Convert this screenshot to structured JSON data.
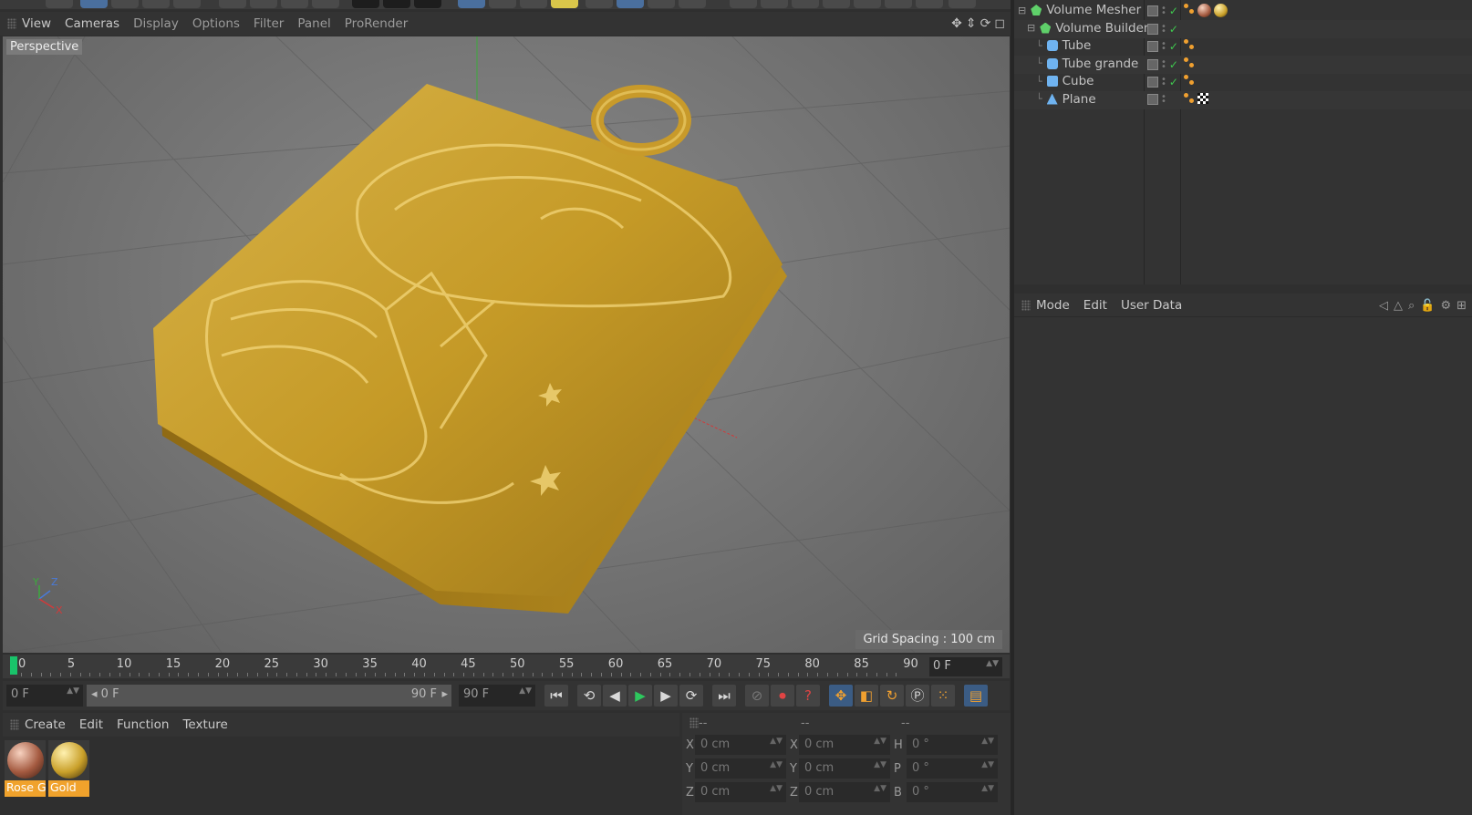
{
  "viewport": {
    "menu": [
      "View",
      "Cameras",
      "Display",
      "Options",
      "Filter",
      "Panel",
      "ProRender"
    ],
    "label": "Perspective",
    "grid_spacing": "Grid Spacing : 100 cm",
    "axis_labels": {
      "y": "Y",
      "z": "Z",
      "x": "X"
    }
  },
  "timeline": {
    "ticks": [
      "0",
      "5",
      "10",
      "15",
      "20",
      "25",
      "30",
      "35",
      "40",
      "45",
      "50",
      "55",
      "60",
      "65",
      "70",
      "75",
      "80",
      "85",
      "90"
    ],
    "current_frame": "0 F"
  },
  "transport": {
    "start_field": "0 F",
    "range_start": "0 F",
    "range_end": "90 F",
    "end_field": "90 F"
  },
  "materials": {
    "menu": [
      "Create",
      "Edit",
      "Function",
      "Texture"
    ],
    "items": [
      {
        "label": "Rose G",
        "color": "#b06a50"
      },
      {
        "label": "Gold",
        "color": "#d9a620"
      }
    ]
  },
  "coordinates": {
    "headers": [
      "--",
      "--",
      "--"
    ],
    "rows": [
      {
        "a": "X",
        "a_val": "0 cm",
        "b": "X",
        "b_val": "0 cm",
        "c": "H",
        "c_val": "0 °"
      },
      {
        "a": "Y",
        "a_val": "0 cm",
        "b": "Y",
        "b_val": "0 cm",
        "c": "P",
        "c_val": "0 °"
      },
      {
        "a": "Z",
        "a_val": "0 cm",
        "b": "Z",
        "b_val": "0 cm",
        "c": "B",
        "c_val": "0 °"
      }
    ]
  },
  "objects": [
    {
      "name": "Volume Mesher",
      "icon": "volume-mesher-icon",
      "indent": 0,
      "tags": [
        "phong",
        "rose-gold-material",
        "gold-material"
      ]
    },
    {
      "name": "Volume Builder",
      "icon": "volume-builder-icon",
      "indent": 1,
      "tags": []
    },
    {
      "name": "Tube",
      "icon": "tube-icon",
      "indent": 2,
      "tags": [
        "phong"
      ]
    },
    {
      "name": "Tube grande",
      "icon": "tube-icon",
      "indent": 2,
      "tags": [
        "phong"
      ]
    },
    {
      "name": "Cube",
      "icon": "cube-icon",
      "indent": 2,
      "tags": [
        "phong"
      ]
    },
    {
      "name": "Plane",
      "icon": "plane-icon",
      "indent": 2,
      "tags": [
        "phong",
        "checker-texture"
      ]
    }
  ],
  "attributes": {
    "menu": [
      "Mode",
      "Edit",
      "User Data"
    ]
  },
  "colors": {
    "accent_orange": "#f0a22c",
    "play_green": "#2ec85e",
    "gold": "#c9a02a"
  }
}
